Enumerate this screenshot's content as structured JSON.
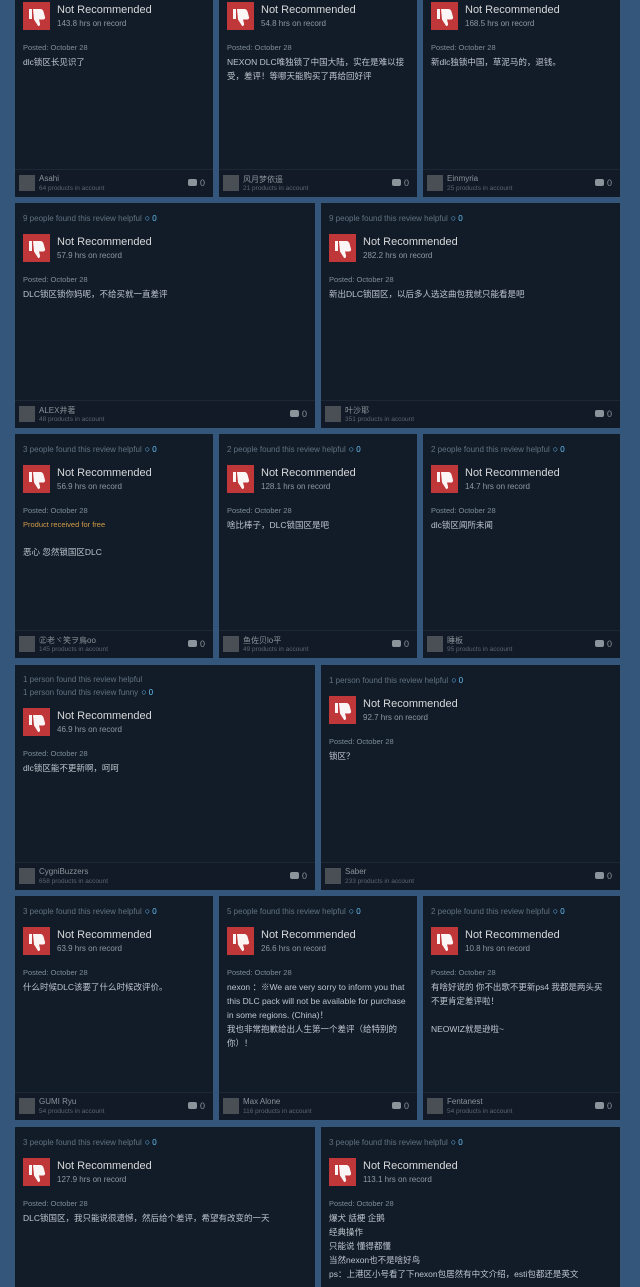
{
  "icons": {
    "thumb": "thumbs-down-icon",
    "award": "award-icon",
    "comment": "comment-icon"
  },
  "colors": {
    "thumb_bg": "#c0373a",
    "award": "#66c0f4",
    "free": "#d09b44",
    "page_bg": "#34567a",
    "card_bg": "#121c29"
  },
  "cards": [
    {
      "helpful": "",
      "helpful2": "",
      "award_count": "",
      "rec": "Not Recommended",
      "hours": "143.8 hrs on record",
      "posted": "Posted: October 28",
      "free": "",
      "body": "dlc锁区长见识了",
      "author": "Asahi",
      "products": "64 products in account",
      "comments": "0"
    },
    {
      "helpful": "",
      "helpful2": "",
      "award_count": "",
      "rec": "Not Recommended",
      "hours": "54.8 hrs on record",
      "posted": "Posted: October 28",
      "free": "",
      "body": "NEXON DLC唯独锁了中国大陆，实在是难以接受，差评！等哪天能购买了再给回好评",
      "author": "风月梦依遥",
      "products": "21 products in account",
      "comments": "0"
    },
    {
      "helpful": "",
      "helpful2": "",
      "award_count": "",
      "rec": "Not Recommended",
      "hours": "168.5 hrs on record",
      "posted": "Posted: October 28",
      "free": "",
      "body": "新dlc独锁中国，草泥马的，退钱。",
      "author": "Einmyria",
      "products": "25 products in account",
      "comments": "0"
    },
    {
      "helpful": "9 people found this review helpful",
      "helpful2": "",
      "award_count": "0",
      "rec": "Not Recommended",
      "hours": "57.9 hrs on record",
      "posted": "Posted: October 28",
      "free": "",
      "body": "DLC锁区锁你妈呢，不给买就一直差评",
      "author": "ALEX井著",
      "products": "48 products in account",
      "comments": "0"
    },
    {
      "helpful": "9 people found this review helpful",
      "helpful2": "",
      "award_count": "0",
      "rec": "Not Recommended",
      "hours": "282.2 hrs on record",
      "posted": "Posted: October 28",
      "free": "",
      "body": "新出DLC锁国区，以后多人选这曲包我就只能看是吧",
      "author": "叶沙耶",
      "products": "351 products in account",
      "comments": "0"
    },
    {
      "helpful": "3 people found this review helpful",
      "helpful2": "",
      "award_count": "0",
      "rec": "Not Recommended",
      "hours": "56.9 hrs on record",
      "posted": "Posted: October 28",
      "free": "Product received for free",
      "body": "恶心 忽然锁国区DLC",
      "author": "㊣老ヾ笑ヲ鳥oo",
      "products": "145 products in account",
      "comments": "0"
    },
    {
      "helpful": "2 people found this review helpful",
      "helpful2": "",
      "award_count": "0",
      "rec": "Not Recommended",
      "hours": "128.1 hrs on record",
      "posted": "Posted: October 28",
      "free": "",
      "body": "啥比棒子，DLC锁国区是吧",
      "author": "鱼佐贝lo平",
      "products": "49 products in account",
      "comments": "0"
    },
    {
      "helpful": "2 people found this review helpful",
      "helpful2": "",
      "award_count": "0",
      "rec": "Not Recommended",
      "hours": "14.7 hrs on record",
      "posted": "Posted: October 28",
      "free": "",
      "body": "dlc锁区闻所未闻",
      "author": "睡板",
      "products": "95 products in account",
      "comments": "0"
    },
    {
      "helpful": "1 person found this review helpful",
      "helpful2": "1 person found this review funny",
      "award_count": "0",
      "rec": "Not Recommended",
      "hours": "46.9 hrs on record",
      "posted": "Posted: October 28",
      "free": "",
      "body": "dlc锁区能不更新啊，呵呵",
      "author": "CygniBuzzers",
      "products": "658 products in account",
      "comments": "0"
    },
    {
      "helpful": "1 person found this review helpful",
      "helpful2": "",
      "award_count": "0",
      "rec": "Not Recommended",
      "hours": "92.7 hrs on record",
      "posted": "Posted: October 28",
      "free": "",
      "body": "锁区？",
      "author": "Saber",
      "products": "233 products in account",
      "comments": "0"
    },
    {
      "helpful": "3 people found this review helpful",
      "helpful2": "",
      "award_count": "0",
      "rec": "Not Recommended",
      "hours": "63.9 hrs on record",
      "posted": "Posted: October 28",
      "free": "",
      "body": "什么时候DLC该要了什么时候改评价。",
      "author": "GUMI Ryu",
      "products": "54 products in account",
      "comments": "0"
    },
    {
      "helpful": "5 people found this review helpful",
      "helpful2": "",
      "award_count": "0",
      "rec": "Not Recommended",
      "hours": "26.6 hrs on record",
      "posted": "Posted: October 28",
      "free": "",
      "body": "nexon ：※We are very sorry to inform you that this DLC pack will not be available for purchase in some regions. (China)！\n我也非常抱歉给出人生第一个差评（给特别的你）！",
      "author": "Max Alone",
      "products": "116 products in account",
      "comments": "0"
    },
    {
      "helpful": "2 people found this review helpful",
      "helpful2": "",
      "award_count": "0",
      "rec": "Not Recommended",
      "hours": "10.8 hrs on record",
      "posted": "Posted: October 28",
      "free": "",
      "body": "有啥好说的 你不出歌不更新ps4 我都是两头买 不更肯定差评啦！\n\nNEOWIZ就是逊啦~",
      "author": "Fentanest",
      "products": "54 products in account",
      "comments": "0"
    },
    {
      "helpful": "3 people found this review helpful",
      "helpful2": "",
      "award_count": "0",
      "rec": "Not Recommended",
      "hours": "127.9 hrs on record",
      "posted": "Posted: October 28",
      "free": "",
      "body": "DLC锁国区，我只能说很遗憾，然后给个差评，希望有改变的一天",
      "author": "",
      "products": "",
      "comments": ""
    },
    {
      "helpful": "3 people found this review helpful",
      "helpful2": "",
      "award_count": "0",
      "rec": "Not Recommended",
      "hours": "113.1 hrs on record",
      "posted": "Posted: October 28",
      "free": "",
      "body": "爆犬 話梗 企鹅\n经典操作\n只能说 懂得都懂\n当然nexon也不是啥好鸟\nps：上港区小号看了下nexon包居然有中文介绍，esti包都还是英文",
      "author": "",
      "products": "",
      "comments": ""
    }
  ]
}
